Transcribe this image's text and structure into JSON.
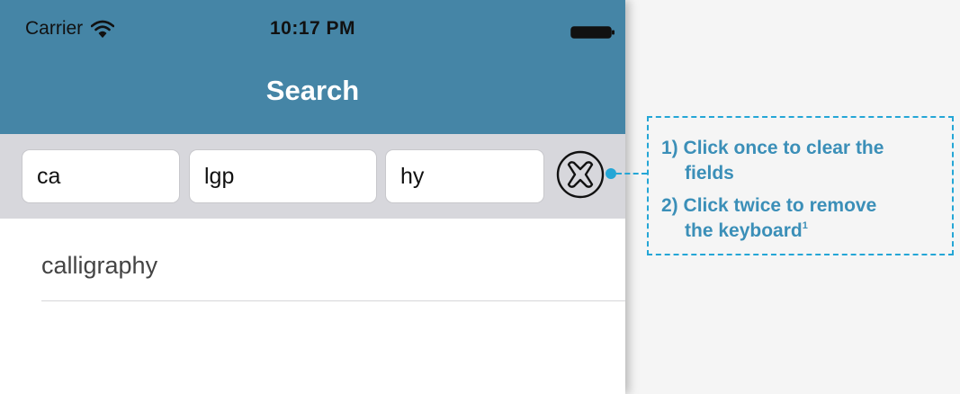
{
  "status_bar": {
    "carrier": "Carrier",
    "time": "10:17 PM"
  },
  "nav": {
    "title": "Search"
  },
  "search": {
    "field1_value": "ca",
    "field2_value": "lgp",
    "field3_value": "hy",
    "clear_icon": "clear-x-circle-icon"
  },
  "results": [
    {
      "label": "calligraphy"
    }
  ],
  "callout": {
    "step1_num": "1)",
    "step1_line1": "Click once to clear the",
    "step1_line2": "fields",
    "step2_num": "2)",
    "step2_line1": "Click twice to remove",
    "step2_line2": "the keyboard",
    "footnote_mark": "1"
  },
  "colors": {
    "nav_bar": "#4585a6",
    "search_bar": "#d7d7dc",
    "callout_accent": "#24a6d6",
    "callout_text": "#3b8fb8"
  }
}
